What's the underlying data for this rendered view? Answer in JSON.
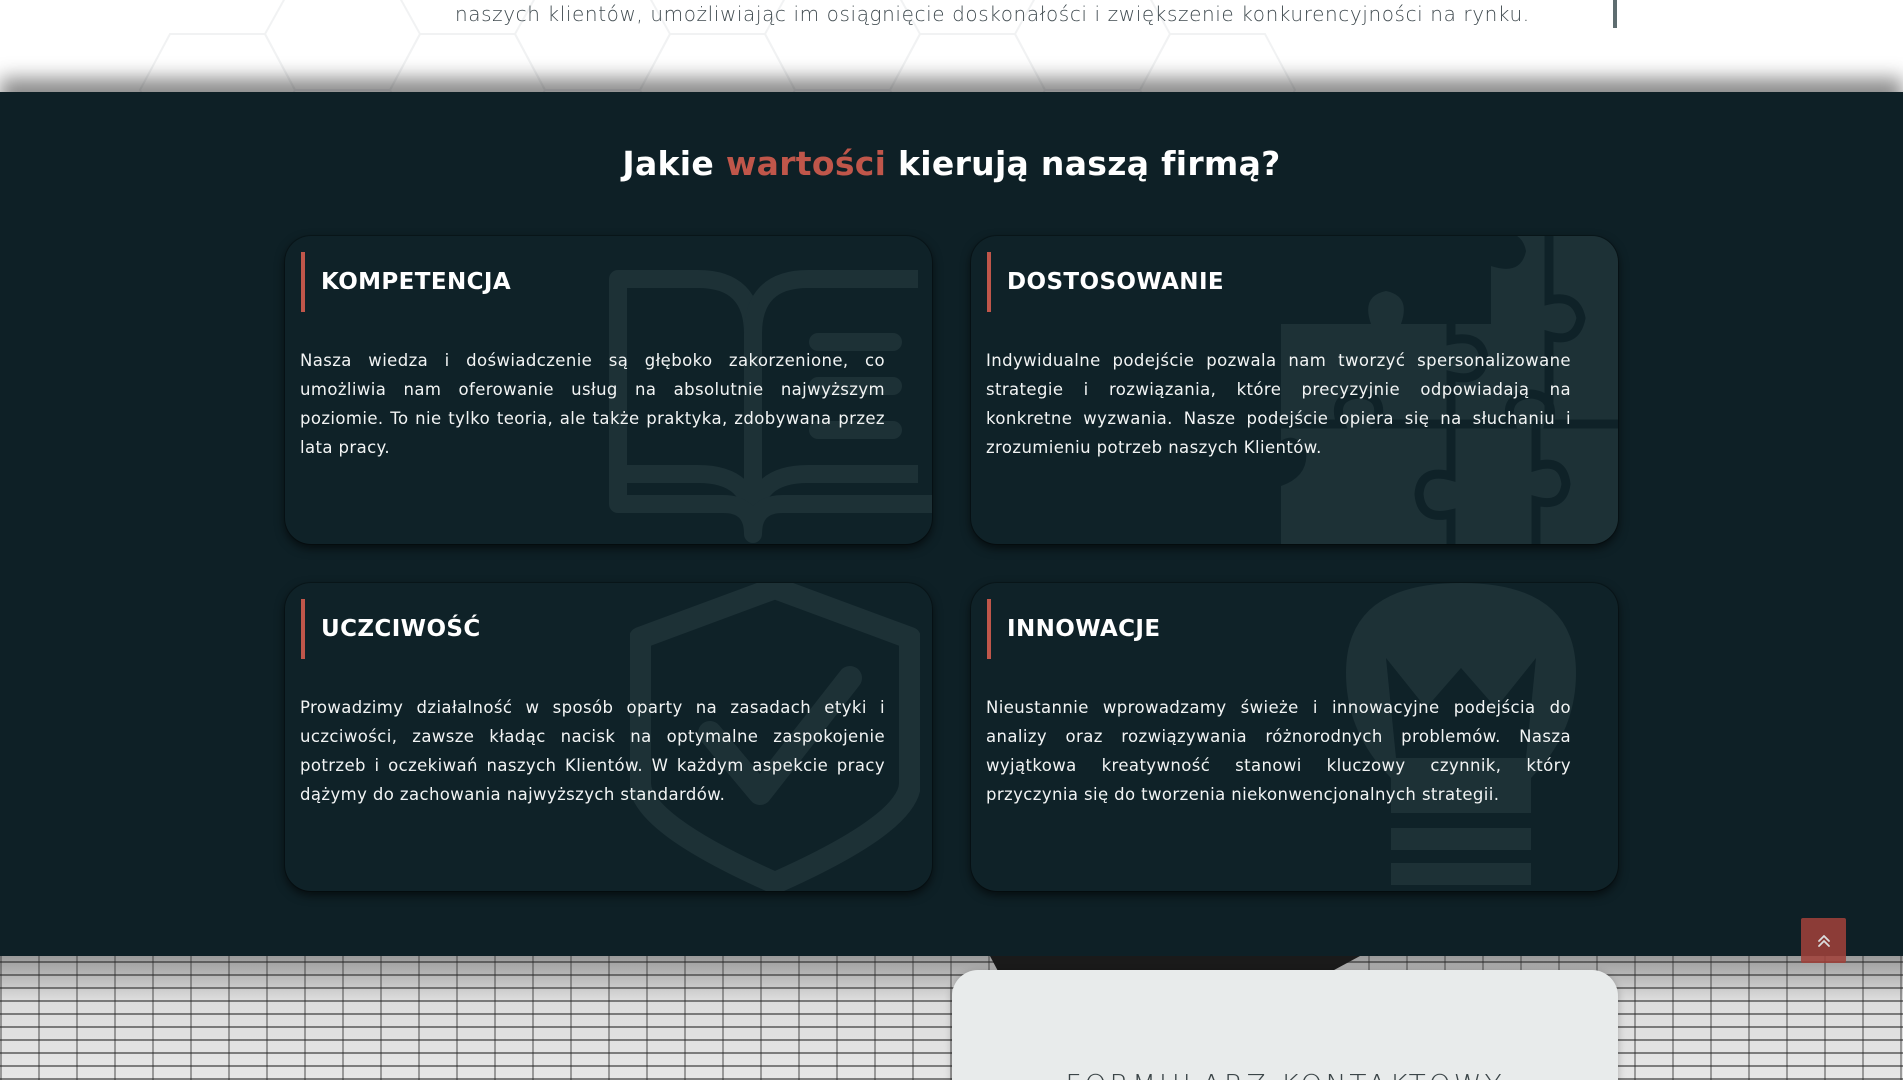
{
  "intro": {
    "text": "naszych klientów, umożliwiając im osiągnięcie doskonałości i zwiększenie konkurencyjności na rynku."
  },
  "values": {
    "title_before": "Jakie ",
    "title_accent": "wartości",
    "title_after": " kierują naszą firmą?",
    "cards": [
      {
        "title": "KOMPETENCJA",
        "icon": "open-book-icon",
        "text": "Nasza wiedza i doświadczenie są głęboko zakorzenione, co umożliwia nam oferowanie usług na absolutnie najwyższym poziomie. To nie tylko teoria, ale także praktyka, zdobywana przez lata pracy."
      },
      {
        "title": "DOSTOSOWANIE",
        "icon": "puzzle-icon",
        "text": "Indywidualne podejście pozwala nam tworzyć spersonalizowane strategie i rozwiązania, które precyzyjnie odpowiadają na konkretne wyzwania. Nasze podejście opiera się na słuchaniu i zrozumieniu potrzeb naszych Klientów."
      },
      {
        "title": "UCZCIWOŚĆ",
        "icon": "shield-check-icon",
        "text": "Prowadzimy działalność w sposób oparty na zasadach etyki i uczciwości, zawsze kładąc nacisk na optymalne zaspokojenie potrzeb i oczekiwań naszych Klientów. W każdym aspekcie pracy dążymy do zachowania najwyższych standardów."
      },
      {
        "title": "INNOWACJE",
        "icon": "lightbulb-icon",
        "text": "Nieustannie wprowadzamy świeże i innowacyjne podejścia do analizy oraz rozwiązywania różnorodnych problemów. Nasza wyjątkowa kreatywność stanowi kluczowy czynnik, który przyczynia się do tworzenia niekonwencjonalnych strategii."
      }
    ]
  },
  "contact": {
    "form_title": "FORMULARZ KONTAKTOWY"
  },
  "scroll_top": {
    "icon": "double-chevron-up-icon"
  },
  "colors": {
    "accent": "#c0564a",
    "section_bg": "#0e2026",
    "card_bg": "#0f2228",
    "icon_watermark": "#1d3136"
  }
}
